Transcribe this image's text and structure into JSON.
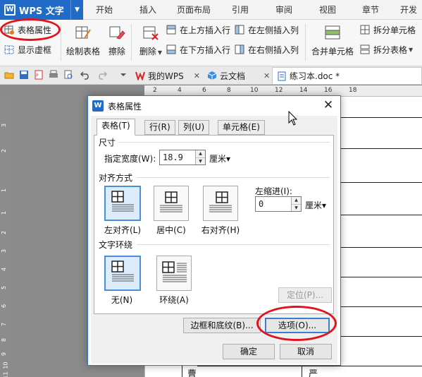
{
  "app": {
    "name": "WPS 文字",
    "logo_letter": "W",
    "accent": "#1f6bc7"
  },
  "menu": [
    {
      "label": "开始"
    },
    {
      "label": "插入"
    },
    {
      "label": "页面布局"
    },
    {
      "label": "引用"
    },
    {
      "label": "审阅"
    },
    {
      "label": "视图"
    },
    {
      "label": "章节"
    },
    {
      "label": "开发工"
    }
  ],
  "ribbon": {
    "table_props": "表格属性",
    "show_gridlines": "显示虚框",
    "draw_table": "绘制表格",
    "erase": "擦除",
    "delete": "删除",
    "insert_above": "在上方插入行",
    "insert_below": "在下方插入行",
    "insert_left": "在左侧插入列",
    "insert_right": "在右侧插入列",
    "merge_cells": "合并单元格",
    "split_cells": "拆分单元格",
    "split_table": "拆分表格"
  },
  "tabs": [
    {
      "label": "我的WPS"
    },
    {
      "label": "云文档"
    },
    {
      "label": "练习本.doc *"
    }
  ],
  "ruler": {
    "h_numbers": [
      "2",
      "4",
      "6",
      "8",
      "10",
      "12",
      "14",
      "16",
      "18"
    ],
    "v_numbers": [
      "3",
      "2",
      "1",
      "1",
      "2",
      "3",
      "4",
      "5",
      "6",
      "7",
      "8",
      "9",
      "10",
      "11"
    ]
  },
  "page_text": {
    "left_char": "曹",
    "right_char": "严"
  },
  "dialog": {
    "title": "表格属性",
    "close_glyph": "✕",
    "tabs": [
      {
        "label": "表格(T)"
      },
      {
        "label": "行(R)"
      },
      {
        "label": "列(U)"
      },
      {
        "label": "单元格(E)"
      }
    ],
    "size_group": "尺寸",
    "width_label": "指定宽度(W):",
    "width_value": "18.9",
    "width_unit": "厘米▾",
    "align_group": "对齐方式",
    "align_options": [
      {
        "label": "左对齐(L)",
        "selected": true
      },
      {
        "label": "居中(C)",
        "selected": false
      },
      {
        "label": "右对齐(H)",
        "selected": false
      }
    ],
    "indent_label": "左缩进(I):",
    "indent_value": "0",
    "indent_unit": "厘米▾",
    "wrap_group": "文字环绕",
    "wrap_options": [
      {
        "label": "无(N)",
        "selected": true
      },
      {
        "label": "环绕(A)",
        "selected": false
      }
    ],
    "position_button": "定位(P)...",
    "borders_button": "边框和底纹(B)...",
    "options_button": "选项(O)...",
    "ok_button": "确定",
    "cancel_button": "取消"
  },
  "annotation_color": "#e0141e"
}
